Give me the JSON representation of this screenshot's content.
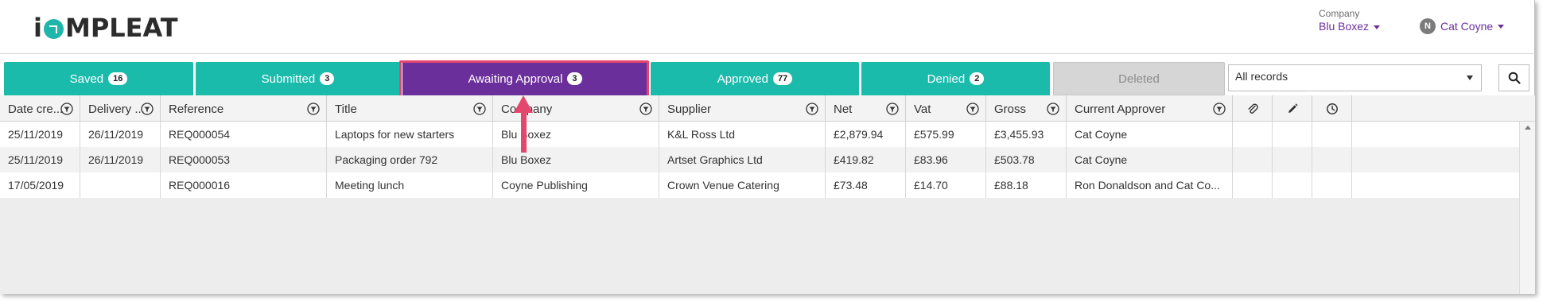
{
  "header": {
    "logo_prefix": "i",
    "logo_suffix": "MPLEAT",
    "company_label": "Company",
    "company_value": "Blu Boxez",
    "user_initial": "N",
    "user_name": "Cat Coyne"
  },
  "tabs": [
    {
      "label": "Saved",
      "count": "16"
    },
    {
      "label": "Submitted",
      "count": "3"
    },
    {
      "label": "Awaiting Approval",
      "count": "3"
    },
    {
      "label": "Approved",
      "count": "77"
    },
    {
      "label": "Denied",
      "count": "2"
    },
    {
      "label": "Deleted"
    }
  ],
  "filter": {
    "selected": "All records"
  },
  "columns": [
    "Date cre...",
    "Delivery ...",
    "Reference",
    "Title",
    "Company",
    "Supplier",
    "Net",
    "Vat",
    "Gross",
    "Current Approver"
  ],
  "icon_columns": [
    "paperclip-icon",
    "pencil-icon",
    "clock-icon"
  ],
  "rows": [
    [
      "25/11/2019",
      "26/11/2019",
      "REQ000054",
      "Laptops for new starters",
      "Blu Boxez",
      "K&L Ross Ltd",
      "£2,879.94",
      "£575.99",
      "£3,455.93",
      "Cat Coyne"
    ],
    [
      "25/11/2019",
      "26/11/2019",
      "REQ000053",
      "Packaging order 792",
      "Blu Boxez",
      "Artset Graphics Ltd",
      "£419.82",
      "£83.96",
      "£503.78",
      "Cat Coyne"
    ],
    [
      "17/05/2019",
      "",
      "REQ000016",
      "Meeting lunch",
      "Coyne Publishing",
      "Crown Venue Catering",
      "£73.48",
      "£14.70",
      "£88.18",
      "Ron Donaldson and Cat Co..."
    ]
  ],
  "colors": {
    "teal": "#1bbbac",
    "purple": "#6b2f9b",
    "highlight": "#e5466e"
  }
}
